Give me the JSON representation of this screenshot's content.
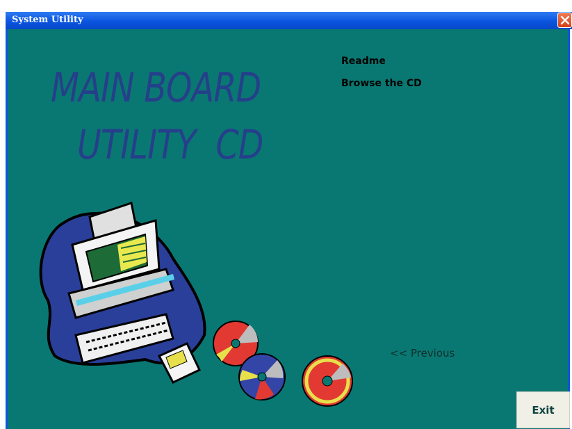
{
  "window": {
    "title": "System Utility"
  },
  "watermark": {
    "line1": "MAIN BOARD",
    "line2": "UTILITY  CD"
  },
  "menu": {
    "readme": "Readme",
    "browse": "Browse the CD"
  },
  "nav": {
    "previous": "<< Previous"
  },
  "buttons": {
    "exit": "Exit"
  },
  "colors": {
    "background": "#0a7872",
    "titlebar": "#0a55df",
    "watermark": "#253f8a"
  }
}
